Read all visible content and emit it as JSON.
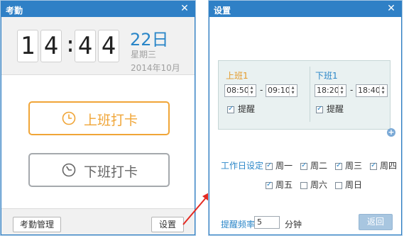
{
  "attendance_window": {
    "title": "考勤",
    "close_glyph": "✕",
    "clock": {
      "h1": "1",
      "h2": "4",
      "sep": ":",
      "m1": "4",
      "m2": "4"
    },
    "date": {
      "day": "22日",
      "weekday": "星期三",
      "year_month": "2014年10月"
    },
    "punch_in_label": "上班打卡",
    "punch_out_label": "下班打卡",
    "manage_button": "考勤管理",
    "settings_button": "设置",
    "accent_color": "#f0a537"
  },
  "settings_window": {
    "title": "设置",
    "close_glyph": "✕",
    "schedule": {
      "start_label": "上班1",
      "end_label": "下班1",
      "start_from": "08:50",
      "start_to": "09:10",
      "end_from": "18:20",
      "end_to": "18:40",
      "separator": "-",
      "remind_label": "提醒",
      "start_remind_checked": true,
      "end_remind_checked": true
    },
    "workday_label": "工作日设定",
    "days": [
      {
        "label": "周一",
        "checked": true
      },
      {
        "label": "周二",
        "checked": true
      },
      {
        "label": "周三",
        "checked": true
      },
      {
        "label": "周四",
        "checked": true
      },
      {
        "label": "周五",
        "checked": true
      },
      {
        "label": "周六",
        "checked": false
      },
      {
        "label": "周日",
        "checked": false
      }
    ],
    "frequency_label": "提醒频率",
    "frequency_value": "5",
    "frequency_unit": "分钟",
    "back_button": "返回",
    "accent_color": "#2a86c8"
  },
  "icons": {
    "clock_icon": "clock-icon",
    "close_icon": "close-icon",
    "add_icon": "add-schedule-icon",
    "arrow": "pointer-arrow"
  }
}
